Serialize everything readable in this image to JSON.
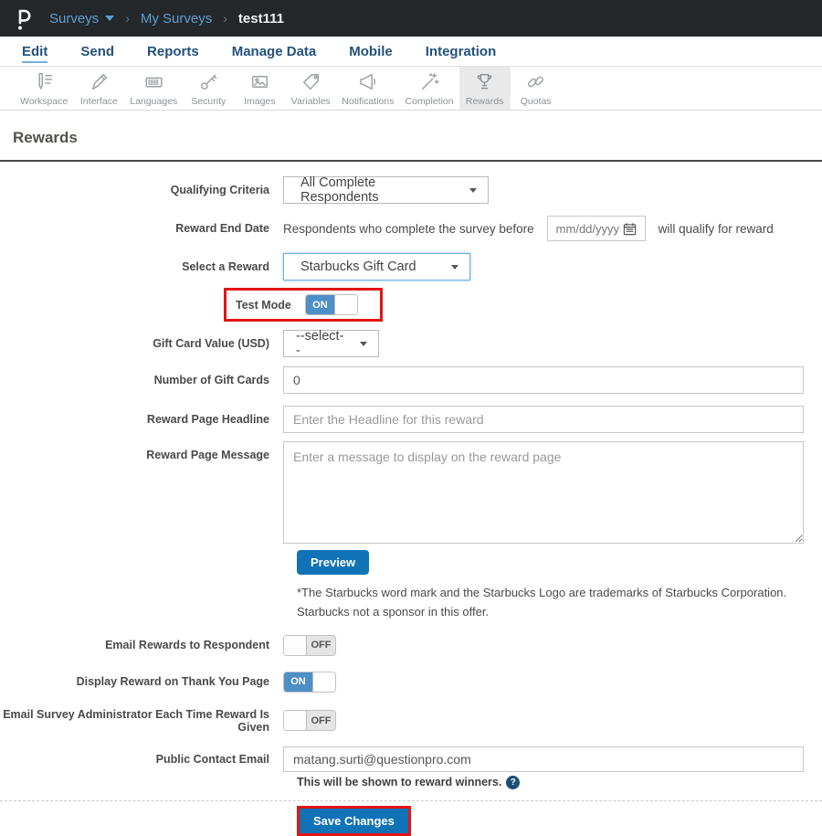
{
  "topbar": {
    "breadcrumb": {
      "surveys": "Surveys",
      "my_surveys": "My Surveys",
      "survey_name": "test111"
    }
  },
  "nav": {
    "tabs": [
      {
        "label": "Edit",
        "active": true
      },
      {
        "label": "Send",
        "active": false
      },
      {
        "label": "Reports",
        "active": false
      },
      {
        "label": "Manage Data",
        "active": false
      },
      {
        "label": "Mobile",
        "active": false
      },
      {
        "label": "Integration",
        "active": false
      }
    ]
  },
  "toolbar": {
    "items": [
      {
        "label": "Workspace",
        "icon": "pencil-list-icon"
      },
      {
        "label": "Interface",
        "icon": "pen-icon"
      },
      {
        "label": "Languages",
        "icon": "keyboard-icon"
      },
      {
        "label": "Security",
        "icon": "key-icon"
      },
      {
        "label": "Images",
        "icon": "picture-icon"
      },
      {
        "label": "Variables",
        "icon": "tag-icon"
      },
      {
        "label": "Notifications",
        "icon": "megaphone-icon"
      },
      {
        "label": "Completion",
        "icon": "magic-wand-icon"
      },
      {
        "label": "Rewards",
        "icon": "trophy-icon",
        "active": true
      },
      {
        "label": "Quotas",
        "icon": "chain-icon"
      }
    ]
  },
  "page": {
    "title": "Rewards"
  },
  "form": {
    "qualifying_criteria": {
      "label": "Qualifying Criteria",
      "value": "All Complete Respondents"
    },
    "reward_end_date": {
      "label": "Reward End Date",
      "prefix": "Respondents who complete the survey before",
      "placeholder": "mm/dd/yyyy",
      "suffix": "will qualify for reward"
    },
    "select_reward": {
      "label": "Select a Reward",
      "value": "Starbucks Gift Card"
    },
    "test_mode": {
      "label": "Test Mode",
      "state": "ON"
    },
    "gift_card_value": {
      "label": "Gift Card Value (USD)",
      "value": "--select--"
    },
    "number_of_gift_cards": {
      "label": "Number of Gift Cards",
      "value": "0"
    },
    "reward_page_headline": {
      "label": "Reward Page Headline",
      "placeholder": "Enter the Headline for this reward"
    },
    "reward_page_message": {
      "label": "Reward Page Message",
      "placeholder": "Enter a message to display on the reward page"
    },
    "preview_button": "Preview",
    "disclaimer": "*The Starbucks word mark and the Starbucks Logo are trademarks of Starbucks Corporation. Starbucks not a sponsor in this offer.",
    "email_rewards_to_respondent": {
      "label": "Email Rewards to Respondent",
      "state": "OFF"
    },
    "display_reward_on_thank_you_page": {
      "label": "Display Reward on Thank You Page",
      "state": "ON"
    },
    "email_survey_administrator": {
      "label": "Email Survey Administrator Each Time Reward Is Given",
      "state": "OFF"
    },
    "public_contact_email": {
      "label": "Public Contact Email",
      "value": "matang.surti@questionpro.com",
      "helper": "This will be shown to reward winners.",
      "help_icon": "?"
    },
    "save_button": "Save Changes"
  },
  "colors": {
    "topbar_bg": "#25282b",
    "breadcrumb_link": "#5b9fd0",
    "tab_text": "#23527c",
    "accent_blue": "#1173b7",
    "toggle_on_blue": "#4d8fc6",
    "highlight_red": "#e21414"
  }
}
